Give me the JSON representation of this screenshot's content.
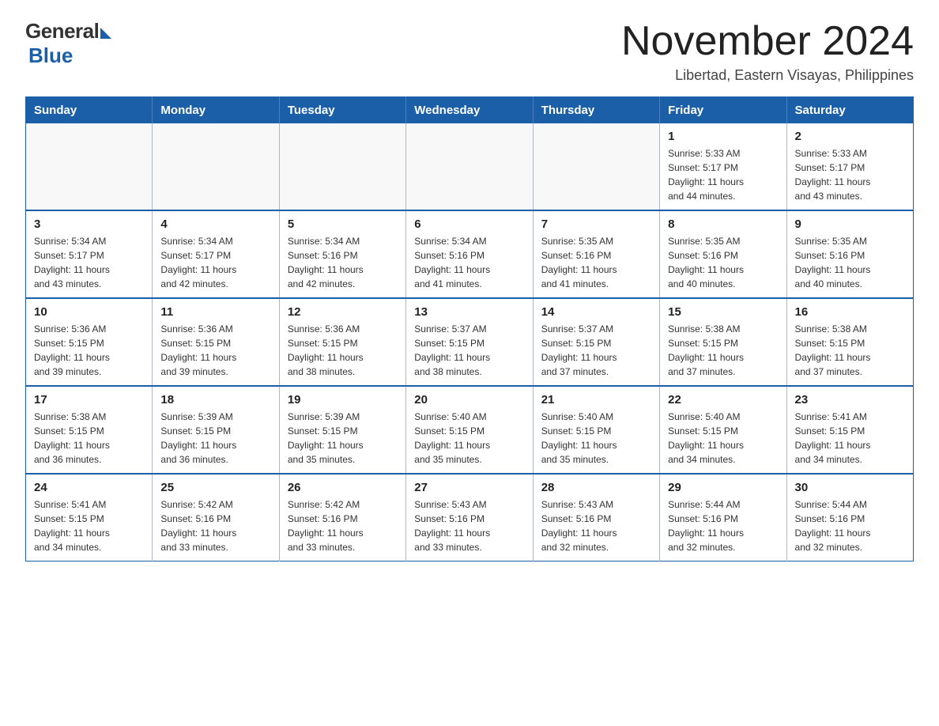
{
  "logo": {
    "general": "General",
    "blue": "Blue"
  },
  "title": "November 2024",
  "subtitle": "Libertad, Eastern Visayas, Philippines",
  "header": {
    "days": [
      "Sunday",
      "Monday",
      "Tuesday",
      "Wednesday",
      "Thursday",
      "Friday",
      "Saturday"
    ]
  },
  "weeks": [
    [
      {
        "day": "",
        "info": ""
      },
      {
        "day": "",
        "info": ""
      },
      {
        "day": "",
        "info": ""
      },
      {
        "day": "",
        "info": ""
      },
      {
        "day": "",
        "info": ""
      },
      {
        "day": "1",
        "info": "Sunrise: 5:33 AM\nSunset: 5:17 PM\nDaylight: 11 hours\nand 44 minutes."
      },
      {
        "day": "2",
        "info": "Sunrise: 5:33 AM\nSunset: 5:17 PM\nDaylight: 11 hours\nand 43 minutes."
      }
    ],
    [
      {
        "day": "3",
        "info": "Sunrise: 5:34 AM\nSunset: 5:17 PM\nDaylight: 11 hours\nand 43 minutes."
      },
      {
        "day": "4",
        "info": "Sunrise: 5:34 AM\nSunset: 5:17 PM\nDaylight: 11 hours\nand 42 minutes."
      },
      {
        "day": "5",
        "info": "Sunrise: 5:34 AM\nSunset: 5:16 PM\nDaylight: 11 hours\nand 42 minutes."
      },
      {
        "day": "6",
        "info": "Sunrise: 5:34 AM\nSunset: 5:16 PM\nDaylight: 11 hours\nand 41 minutes."
      },
      {
        "day": "7",
        "info": "Sunrise: 5:35 AM\nSunset: 5:16 PM\nDaylight: 11 hours\nand 41 minutes."
      },
      {
        "day": "8",
        "info": "Sunrise: 5:35 AM\nSunset: 5:16 PM\nDaylight: 11 hours\nand 40 minutes."
      },
      {
        "day": "9",
        "info": "Sunrise: 5:35 AM\nSunset: 5:16 PM\nDaylight: 11 hours\nand 40 minutes."
      }
    ],
    [
      {
        "day": "10",
        "info": "Sunrise: 5:36 AM\nSunset: 5:15 PM\nDaylight: 11 hours\nand 39 minutes."
      },
      {
        "day": "11",
        "info": "Sunrise: 5:36 AM\nSunset: 5:15 PM\nDaylight: 11 hours\nand 39 minutes."
      },
      {
        "day": "12",
        "info": "Sunrise: 5:36 AM\nSunset: 5:15 PM\nDaylight: 11 hours\nand 38 minutes."
      },
      {
        "day": "13",
        "info": "Sunrise: 5:37 AM\nSunset: 5:15 PM\nDaylight: 11 hours\nand 38 minutes."
      },
      {
        "day": "14",
        "info": "Sunrise: 5:37 AM\nSunset: 5:15 PM\nDaylight: 11 hours\nand 37 minutes."
      },
      {
        "day": "15",
        "info": "Sunrise: 5:38 AM\nSunset: 5:15 PM\nDaylight: 11 hours\nand 37 minutes."
      },
      {
        "day": "16",
        "info": "Sunrise: 5:38 AM\nSunset: 5:15 PM\nDaylight: 11 hours\nand 37 minutes."
      }
    ],
    [
      {
        "day": "17",
        "info": "Sunrise: 5:38 AM\nSunset: 5:15 PM\nDaylight: 11 hours\nand 36 minutes."
      },
      {
        "day": "18",
        "info": "Sunrise: 5:39 AM\nSunset: 5:15 PM\nDaylight: 11 hours\nand 36 minutes."
      },
      {
        "day": "19",
        "info": "Sunrise: 5:39 AM\nSunset: 5:15 PM\nDaylight: 11 hours\nand 35 minutes."
      },
      {
        "day": "20",
        "info": "Sunrise: 5:40 AM\nSunset: 5:15 PM\nDaylight: 11 hours\nand 35 minutes."
      },
      {
        "day": "21",
        "info": "Sunrise: 5:40 AM\nSunset: 5:15 PM\nDaylight: 11 hours\nand 35 minutes."
      },
      {
        "day": "22",
        "info": "Sunrise: 5:40 AM\nSunset: 5:15 PM\nDaylight: 11 hours\nand 34 minutes."
      },
      {
        "day": "23",
        "info": "Sunrise: 5:41 AM\nSunset: 5:15 PM\nDaylight: 11 hours\nand 34 minutes."
      }
    ],
    [
      {
        "day": "24",
        "info": "Sunrise: 5:41 AM\nSunset: 5:15 PM\nDaylight: 11 hours\nand 34 minutes."
      },
      {
        "day": "25",
        "info": "Sunrise: 5:42 AM\nSunset: 5:16 PM\nDaylight: 11 hours\nand 33 minutes."
      },
      {
        "day": "26",
        "info": "Sunrise: 5:42 AM\nSunset: 5:16 PM\nDaylight: 11 hours\nand 33 minutes."
      },
      {
        "day": "27",
        "info": "Sunrise: 5:43 AM\nSunset: 5:16 PM\nDaylight: 11 hours\nand 33 minutes."
      },
      {
        "day": "28",
        "info": "Sunrise: 5:43 AM\nSunset: 5:16 PM\nDaylight: 11 hours\nand 32 minutes."
      },
      {
        "day": "29",
        "info": "Sunrise: 5:44 AM\nSunset: 5:16 PM\nDaylight: 11 hours\nand 32 minutes."
      },
      {
        "day": "30",
        "info": "Sunrise: 5:44 AM\nSunset: 5:16 PM\nDaylight: 11 hours\nand 32 minutes."
      }
    ]
  ]
}
